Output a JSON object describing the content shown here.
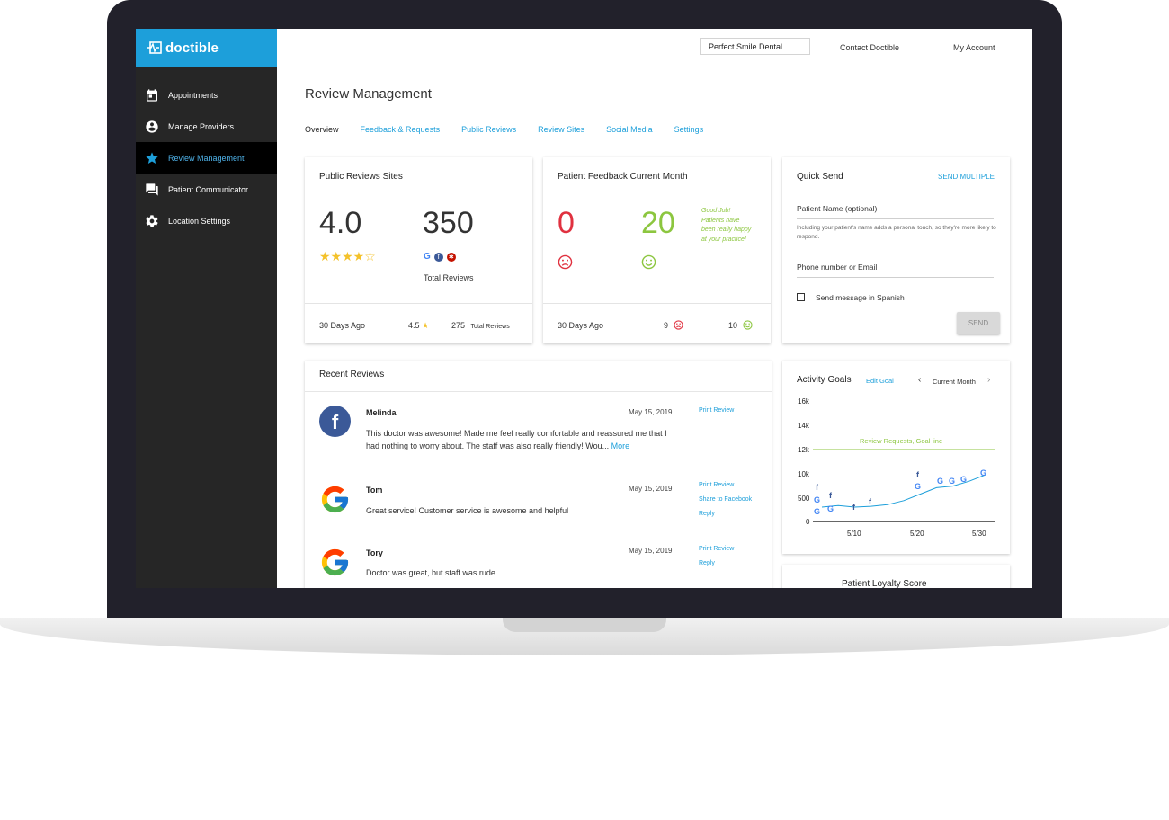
{
  "app": {
    "brand": "doctible"
  },
  "sidebar": {
    "items": [
      {
        "label": "Appointments",
        "icon": "calendar-icon"
      },
      {
        "label": "Manage Providers",
        "icon": "user-circle-icon"
      },
      {
        "label": "Review Management",
        "icon": "star-icon"
      },
      {
        "label": "Patient Communicator",
        "icon": "chat-icon"
      },
      {
        "label": "Location Settings",
        "icon": "gear-icon"
      }
    ]
  },
  "topbar": {
    "practice": "Perfect Smile Dental",
    "contact": "Contact Doctible",
    "account": "My Account"
  },
  "page": {
    "title": "Review Management"
  },
  "tabs": [
    "Overview",
    "Feedback & Requests",
    "Public Reviews",
    "Review Sites",
    "Social Media",
    "Settings"
  ],
  "public_reviews": {
    "title": "Public Reviews Sites",
    "rating": "4.0",
    "stars": 4,
    "total": "350",
    "total_label": "Total Reviews",
    "footer_label": "30 Days Ago",
    "footer_rating": "4.5",
    "footer_total": "275",
    "footer_total_label": "Total Reviews"
  },
  "feedback": {
    "title": "Patient Feedback Current Month",
    "negative": "0",
    "positive": "20",
    "message": "Good Job! Patients have been really happy at your practice!",
    "footer_label": "30 Days Ago",
    "footer_negative": "9",
    "footer_positive": "10",
    "colors": {
      "negative": "#e0313f",
      "positive": "#8cc63f"
    }
  },
  "quick_send": {
    "title": "Quick Send",
    "multiple": "SEND MULTIPLE",
    "name_placeholder": "Patient Name (optional)",
    "name_hint": "Including your patient's name adds a personal touch, so they're more likely to respond.",
    "contact_placeholder": "Phone number or Email",
    "spanish_label": "Send message in Spanish",
    "send": "SEND"
  },
  "recent_reviews": {
    "title": "Recent Reviews",
    "items": [
      {
        "source": "facebook",
        "name": "Melinda",
        "date": "May 15, 2019",
        "text": "This doctor was awesome! Made me feel really comfortable and reassured me that I had nothing to worry about. The staff was also really friendly! Wou...",
        "more": "More",
        "links": [
          "Print Review"
        ]
      },
      {
        "source": "google",
        "name": "Tom",
        "date": "May 15, 2019",
        "text": "Great service! Customer service is awesome and helpful",
        "links": [
          "Print Review",
          "Share to Facebook",
          "Reply"
        ]
      },
      {
        "source": "google",
        "name": "Tory",
        "date": "May 15, 2019",
        "text": "Doctor was great, but staff was rude.",
        "links": [
          "Print Review",
          "Reply"
        ]
      }
    ]
  },
  "activity": {
    "title": "Activity Goals",
    "edit": "Edit Goal",
    "period": "Current Month",
    "goal_label": "Review Requests, Goal line"
  },
  "loyalty": {
    "title": "Patient Loyalty Score"
  },
  "chart_data": {
    "type": "line",
    "title": "Activity Goals",
    "x_ticks": [
      "5/10",
      "5/20",
      "5/30"
    ],
    "y_ticks": [
      "16k",
      "14k",
      "12k",
      "10k",
      "500",
      "0"
    ],
    "goal_label": "Review Requests, Goal line",
    "goal_tick": "12k",
    "series": [
      {
        "values": [
          1,
          1.2,
          1.0,
          1.1,
          1.3,
          1.8,
          2.6,
          3.4,
          3.6,
          4.2,
          5.0
        ]
      }
    ],
    "grid": false,
    "colors": {
      "line": "#1d9fda",
      "goal": "#8cc63f"
    }
  }
}
